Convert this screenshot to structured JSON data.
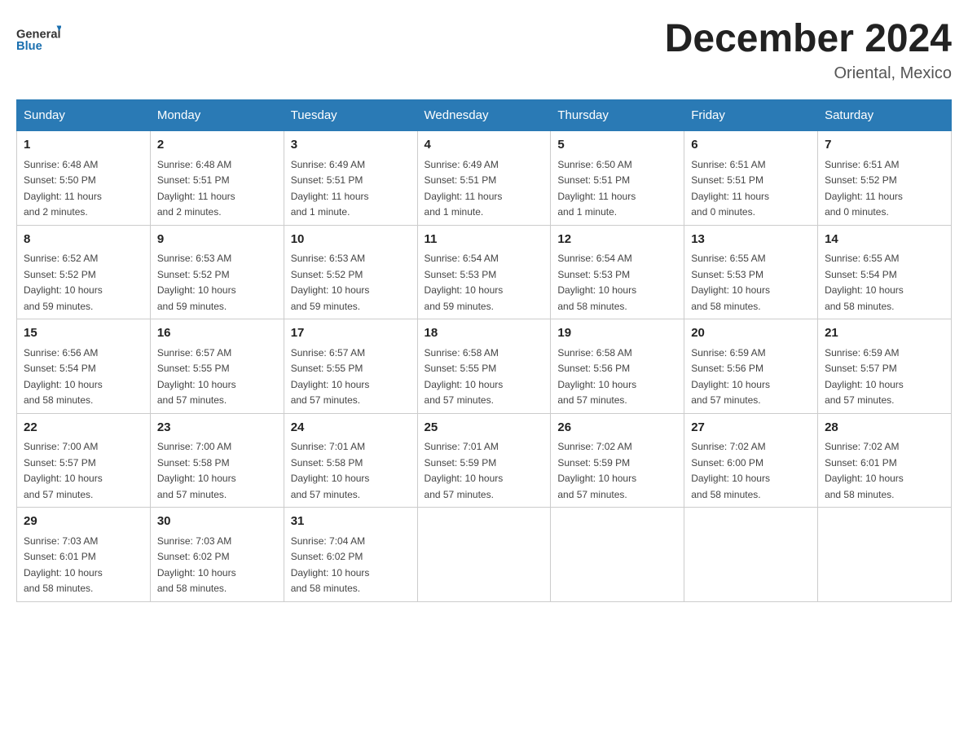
{
  "header": {
    "logo_general": "General",
    "logo_blue": "Blue",
    "title": "December 2024",
    "subtitle": "Oriental, Mexico"
  },
  "days_of_week": [
    "Sunday",
    "Monday",
    "Tuesday",
    "Wednesday",
    "Thursday",
    "Friday",
    "Saturday"
  ],
  "weeks": [
    [
      {
        "day": "1",
        "sunrise": "6:48 AM",
        "sunset": "5:50 PM",
        "daylight": "11 hours and 2 minutes."
      },
      {
        "day": "2",
        "sunrise": "6:48 AM",
        "sunset": "5:51 PM",
        "daylight": "11 hours and 2 minutes."
      },
      {
        "day": "3",
        "sunrise": "6:49 AM",
        "sunset": "5:51 PM",
        "daylight": "11 hours and 1 minute."
      },
      {
        "day": "4",
        "sunrise": "6:49 AM",
        "sunset": "5:51 PM",
        "daylight": "11 hours and 1 minute."
      },
      {
        "day": "5",
        "sunrise": "6:50 AM",
        "sunset": "5:51 PM",
        "daylight": "11 hours and 1 minute."
      },
      {
        "day": "6",
        "sunrise": "6:51 AM",
        "sunset": "5:51 PM",
        "daylight": "11 hours and 0 minutes."
      },
      {
        "day": "7",
        "sunrise": "6:51 AM",
        "sunset": "5:52 PM",
        "daylight": "11 hours and 0 minutes."
      }
    ],
    [
      {
        "day": "8",
        "sunrise": "6:52 AM",
        "sunset": "5:52 PM",
        "daylight": "10 hours and 59 minutes."
      },
      {
        "day": "9",
        "sunrise": "6:53 AM",
        "sunset": "5:52 PM",
        "daylight": "10 hours and 59 minutes."
      },
      {
        "day": "10",
        "sunrise": "6:53 AM",
        "sunset": "5:52 PM",
        "daylight": "10 hours and 59 minutes."
      },
      {
        "day": "11",
        "sunrise": "6:54 AM",
        "sunset": "5:53 PM",
        "daylight": "10 hours and 59 minutes."
      },
      {
        "day": "12",
        "sunrise": "6:54 AM",
        "sunset": "5:53 PM",
        "daylight": "10 hours and 58 minutes."
      },
      {
        "day": "13",
        "sunrise": "6:55 AM",
        "sunset": "5:53 PM",
        "daylight": "10 hours and 58 minutes."
      },
      {
        "day": "14",
        "sunrise": "6:55 AM",
        "sunset": "5:54 PM",
        "daylight": "10 hours and 58 minutes."
      }
    ],
    [
      {
        "day": "15",
        "sunrise": "6:56 AM",
        "sunset": "5:54 PM",
        "daylight": "10 hours and 58 minutes."
      },
      {
        "day": "16",
        "sunrise": "6:57 AM",
        "sunset": "5:55 PM",
        "daylight": "10 hours and 57 minutes."
      },
      {
        "day": "17",
        "sunrise": "6:57 AM",
        "sunset": "5:55 PM",
        "daylight": "10 hours and 57 minutes."
      },
      {
        "day": "18",
        "sunrise": "6:58 AM",
        "sunset": "5:55 PM",
        "daylight": "10 hours and 57 minutes."
      },
      {
        "day": "19",
        "sunrise": "6:58 AM",
        "sunset": "5:56 PM",
        "daylight": "10 hours and 57 minutes."
      },
      {
        "day": "20",
        "sunrise": "6:59 AM",
        "sunset": "5:56 PM",
        "daylight": "10 hours and 57 minutes."
      },
      {
        "day": "21",
        "sunrise": "6:59 AM",
        "sunset": "5:57 PM",
        "daylight": "10 hours and 57 minutes."
      }
    ],
    [
      {
        "day": "22",
        "sunrise": "7:00 AM",
        "sunset": "5:57 PM",
        "daylight": "10 hours and 57 minutes."
      },
      {
        "day": "23",
        "sunrise": "7:00 AM",
        "sunset": "5:58 PM",
        "daylight": "10 hours and 57 minutes."
      },
      {
        "day": "24",
        "sunrise": "7:01 AM",
        "sunset": "5:58 PM",
        "daylight": "10 hours and 57 minutes."
      },
      {
        "day": "25",
        "sunrise": "7:01 AM",
        "sunset": "5:59 PM",
        "daylight": "10 hours and 57 minutes."
      },
      {
        "day": "26",
        "sunrise": "7:02 AM",
        "sunset": "5:59 PM",
        "daylight": "10 hours and 57 minutes."
      },
      {
        "day": "27",
        "sunrise": "7:02 AM",
        "sunset": "6:00 PM",
        "daylight": "10 hours and 58 minutes."
      },
      {
        "day": "28",
        "sunrise": "7:02 AM",
        "sunset": "6:01 PM",
        "daylight": "10 hours and 58 minutes."
      }
    ],
    [
      {
        "day": "29",
        "sunrise": "7:03 AM",
        "sunset": "6:01 PM",
        "daylight": "10 hours and 58 minutes."
      },
      {
        "day": "30",
        "sunrise": "7:03 AM",
        "sunset": "6:02 PM",
        "daylight": "10 hours and 58 minutes."
      },
      {
        "day": "31",
        "sunrise": "7:04 AM",
        "sunset": "6:02 PM",
        "daylight": "10 hours and 58 minutes."
      },
      null,
      null,
      null,
      null
    ]
  ],
  "labels": {
    "sunrise": "Sunrise:",
    "sunset": "Sunset:",
    "daylight": "Daylight:"
  }
}
